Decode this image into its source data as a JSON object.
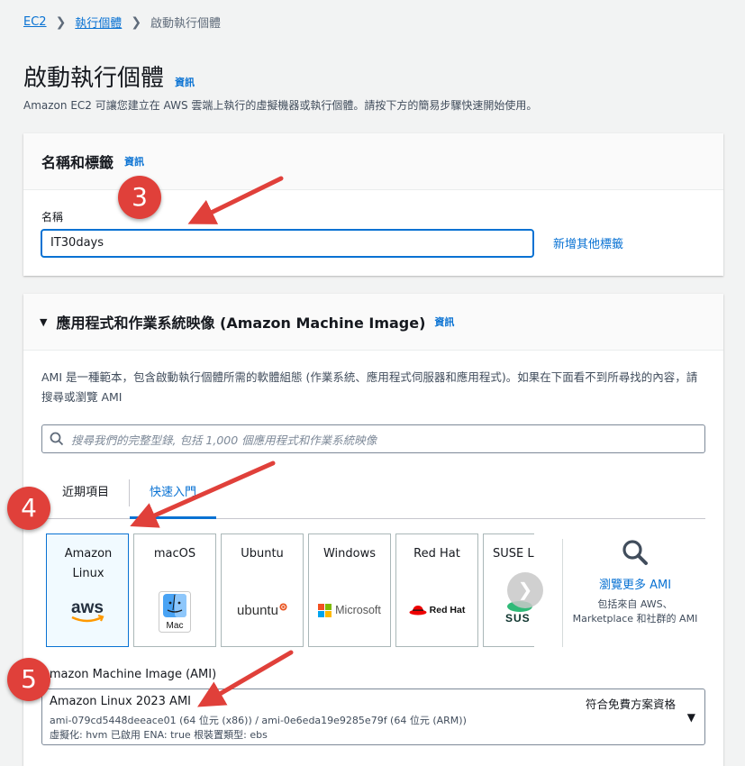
{
  "breadcrumb": {
    "root": "EC2",
    "parent": "執行個體",
    "current": "啟動執行個體"
  },
  "page": {
    "title": "啟動執行個體",
    "info": "資訊",
    "description": "Amazon EC2 可讓您建立在 AWS 雲端上執行的虛擬機器或執行個體。請按下方的簡易步驟快速開始使用。"
  },
  "name_tags": {
    "title": "名稱和標籤",
    "info": "資訊",
    "name_label": "名稱",
    "name_value": "IT30days",
    "add_tags": "新增其他標籤"
  },
  "ami": {
    "title": "應用程式和作業系統映像 (Amazon Machine Image)",
    "info": "資訊",
    "description": "AMI 是一種範本，包含啟動執行個體所需的軟體組態 (作業系統、應用程式伺服器和應用程式)。如果在下面看不到所尋找的內容，請搜尋或瀏覽 AMI",
    "search_placeholder": "搜尋我們的完整型錄, 包括 1,000 個應用程式和作業系統映像",
    "tabs": {
      "recent": "近期項目",
      "quick": "快速入門"
    },
    "tiles": {
      "amazon_linux": "Amazon Linux",
      "amazon_logo": "aws",
      "macos": "macOS",
      "mac_logo": "Mac",
      "ubuntu": "Ubuntu",
      "ubuntu_logo": "ubuntu",
      "windows": "Windows",
      "windows_logo": "Microsoft",
      "redhat": "Red Hat",
      "redhat_logo": "Red Hat",
      "suse": "SUSE Li",
      "suse_logo": "SUS"
    },
    "browse_more": "瀏覽更多 AMI",
    "browse_desc": "包括來自 AWS、Marketplace 和社群的 AMI",
    "select_label": "Amazon Machine Image (AMI)",
    "selected_name": "Amazon Linux 2023 AMI",
    "free_tier": "符合免費方案資格",
    "selected_ids": "ami-079cd5448deeace01 (64 位元 (x86)) / ami-0e6eda19e9285e79f (64 位元 (ARM))",
    "selected_meta": "虛擬化: hvm    已啟用 ENA: true    根裝置類型: ebs"
  },
  "annotations": {
    "step3": "3",
    "step4": "4",
    "step5": "5"
  },
  "colors": {
    "link": "#0972d3",
    "badge": "#e0403a",
    "selected_tile_bg": "#f1faff"
  }
}
